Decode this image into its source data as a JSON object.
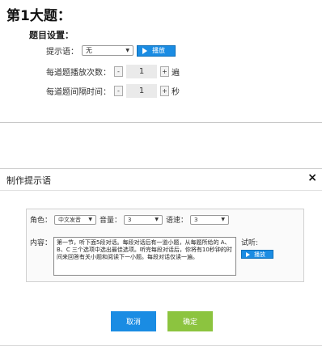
{
  "top": {
    "question_title": "第1大题：",
    "settings_label": "题目设置：",
    "prompt_label": "提示语：",
    "prompt_value": "无",
    "play_label": "播放",
    "play_count_label": "每道题播放次数：",
    "play_count_value": "1",
    "play_count_unit": "遍",
    "interval_label": "每道题间隔时间：",
    "interval_value": "1",
    "interval_unit": "秒",
    "minus": "-",
    "plus": "+"
  },
  "modal": {
    "title": "制作提示语",
    "close": "×",
    "role_label": "角色：",
    "role_value": "中文发音",
    "volume_label": "音量：",
    "volume_value": "3",
    "speed_label": "语速：",
    "speed_value": "3",
    "content_label": "内容：",
    "content_text": "第一节，听下面5段对话。每段对话后有一道小题，从每题所给的 A、B、C 三个选项中选出最佳选项。听完每段对话后，你将有10秒钟的时间来回答有关小题和阅读下一小题。每段对话仅读一遍。",
    "trial_label": "试听:",
    "trial_play": "播放",
    "cancel": "取消",
    "confirm": "确定"
  },
  "colors": {
    "accent": "#1a8ce3",
    "confirm": "#8cc43f"
  },
  "icons": {
    "play": "play-triangle-icon",
    "dropdown": "chevron-down-icon",
    "close": "close-icon"
  }
}
